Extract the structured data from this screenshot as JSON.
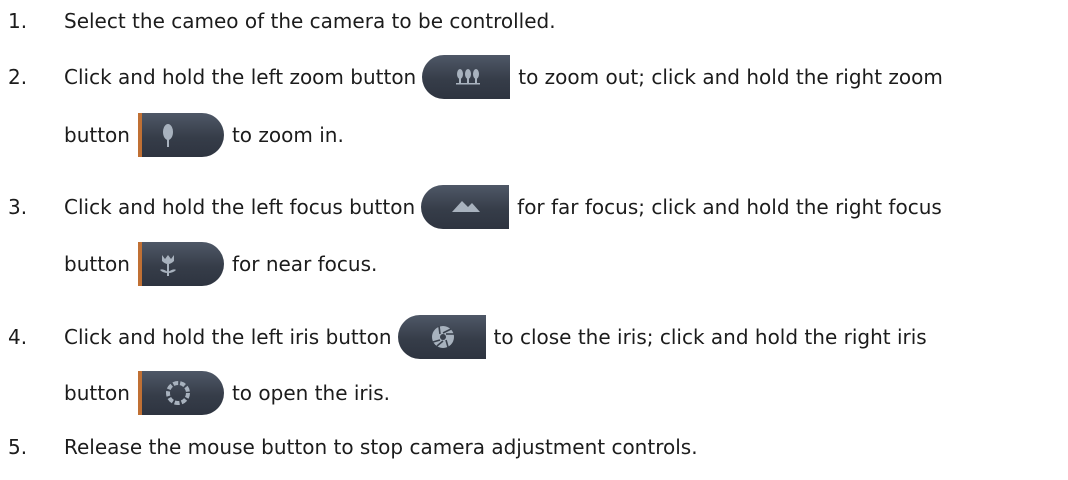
{
  "steps": [
    {
      "num": "1.",
      "text": "Select the cameo of the camera to be controlled."
    },
    {
      "num": "2.",
      "pre": "Click and hold the left zoom button",
      "mid": "to zoom out; click and hold the right zoom",
      "pre2": "button",
      "post": "to zoom in.",
      "icon_left": "zoom-out-trees-icon",
      "icon_right": "zoom-in-tree-icon"
    },
    {
      "num": "3.",
      "pre": "Click and hold the left focus button",
      "mid": "for far focus; click and hold the right focus",
      "pre2": "button",
      "post": "for near focus.",
      "icon_left": "far-focus-mountain-icon",
      "icon_right": "near-focus-flower-icon"
    },
    {
      "num": "4.",
      "pre": "Click and hold the left iris button",
      "mid": "to close the iris; click and hold the right iris",
      "pre2": "button",
      "post": "to open the iris.",
      "icon_left": "iris-close-icon",
      "icon_right": "iris-open-icon"
    },
    {
      "num": "5.",
      "text": "Release the mouse button to stop camera adjustment controls."
    }
  ],
  "colors": {
    "button_bg": "#3a414d",
    "icon": "#a8b2be",
    "accent": "#c07034"
  }
}
